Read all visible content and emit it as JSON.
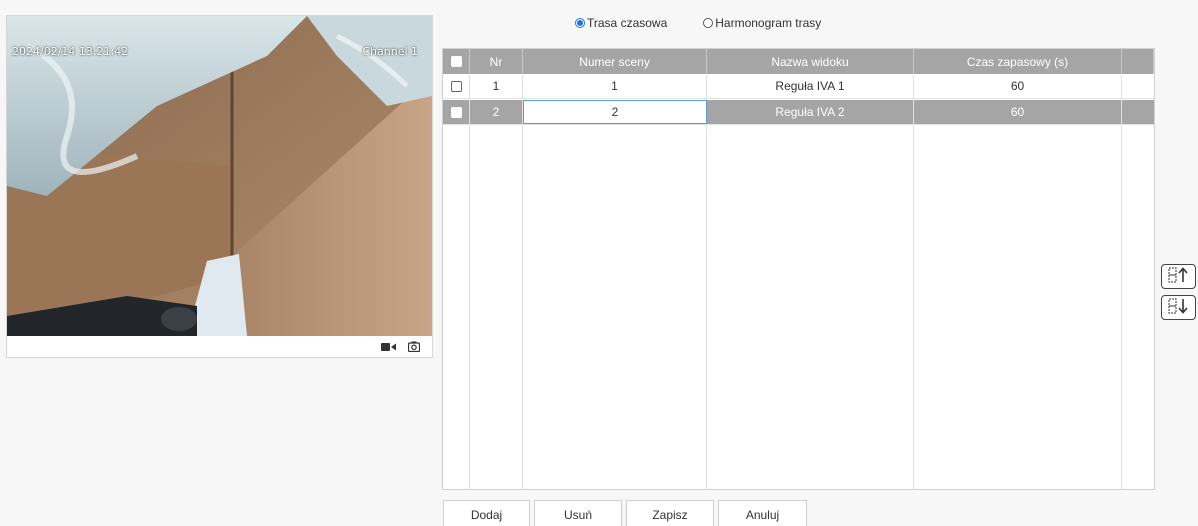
{
  "video": {
    "timestamp": "2024/02/14 13:21:42",
    "channel": "Channel 1",
    "toolbar_icons": [
      "record-icon",
      "snapshot-icon"
    ]
  },
  "mode": {
    "options": [
      {
        "label": "Trasa czasowa",
        "selected": true
      },
      {
        "label": "Harmonogram trasy",
        "selected": false
      }
    ]
  },
  "table": {
    "headers": [
      "Nr",
      "Numer sceny",
      "Nazwa widoku",
      "Czas zapasowy (s)"
    ],
    "rows": [
      {
        "nr": "1",
        "scene": "1",
        "view": "Reguła IVA 1",
        "time": "60",
        "selected": false
      },
      {
        "nr": "2",
        "scene": "2",
        "view": "Reguła IVA 2",
        "time": "60",
        "selected": true
      }
    ]
  },
  "side_buttons": [
    "move-up-icon",
    "move-down-icon"
  ],
  "buttons": {
    "add": "Dodaj",
    "delete": "Usuń",
    "save": "Zapisz",
    "cancel": "Anuluj"
  },
  "colors": {
    "header_bg": "#a5a5a5",
    "accent": "#1e73e8",
    "edit_border": "#5b9bd5"
  }
}
